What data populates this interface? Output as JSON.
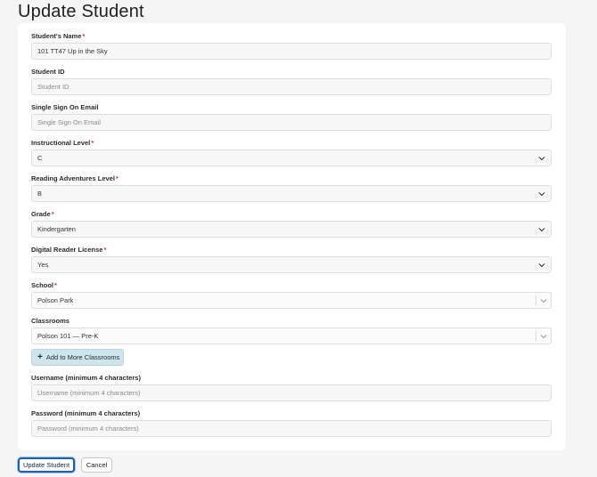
{
  "page": {
    "title": "Update Student"
  },
  "form": {
    "student_name": {
      "label": "Student's Name",
      "value": "101 TT47 Up in the Sky",
      "required": true
    },
    "student_id": {
      "label": "Student ID",
      "placeholder": "Student ID"
    },
    "sso_email": {
      "label": "Single Sign On Email",
      "placeholder": "Single Sign On Email"
    },
    "instructional_level": {
      "label": "Instructional Level",
      "value": "C",
      "required": true
    },
    "reading_adventures_level": {
      "label": "Reading Adventures Level",
      "value": "B",
      "required": true
    },
    "grade": {
      "label": "Grade",
      "value": "Kindergarten",
      "required": true
    },
    "digital_reader_license": {
      "label": "Digital Reader License",
      "value": "Yes",
      "required": true
    },
    "school": {
      "label": "School",
      "value": "Polson Park",
      "required": true
    },
    "classrooms": {
      "label": "Classrooms",
      "value": "Polson 101 — Pre-K"
    },
    "add_classrooms_label": "Add to More Classrooms",
    "username": {
      "label": "Username (minimum 4 characters)",
      "placeholder": "Username (minimum 4 characters)"
    },
    "password": {
      "label": "Password (minimum 4 characters)",
      "placeholder": "Password (minimum 4 characters)"
    },
    "required_marker": "*"
  },
  "footer": {
    "update_label": "Update Student",
    "cancel_label": "Cancel"
  },
  "icons": {
    "dropdown": "chevron-down-icon",
    "add": "plus-icon"
  },
  "colors": {
    "required": "#d2323c",
    "primary_border": "#2060b0",
    "add_button_bg": "#cfe5ec"
  }
}
